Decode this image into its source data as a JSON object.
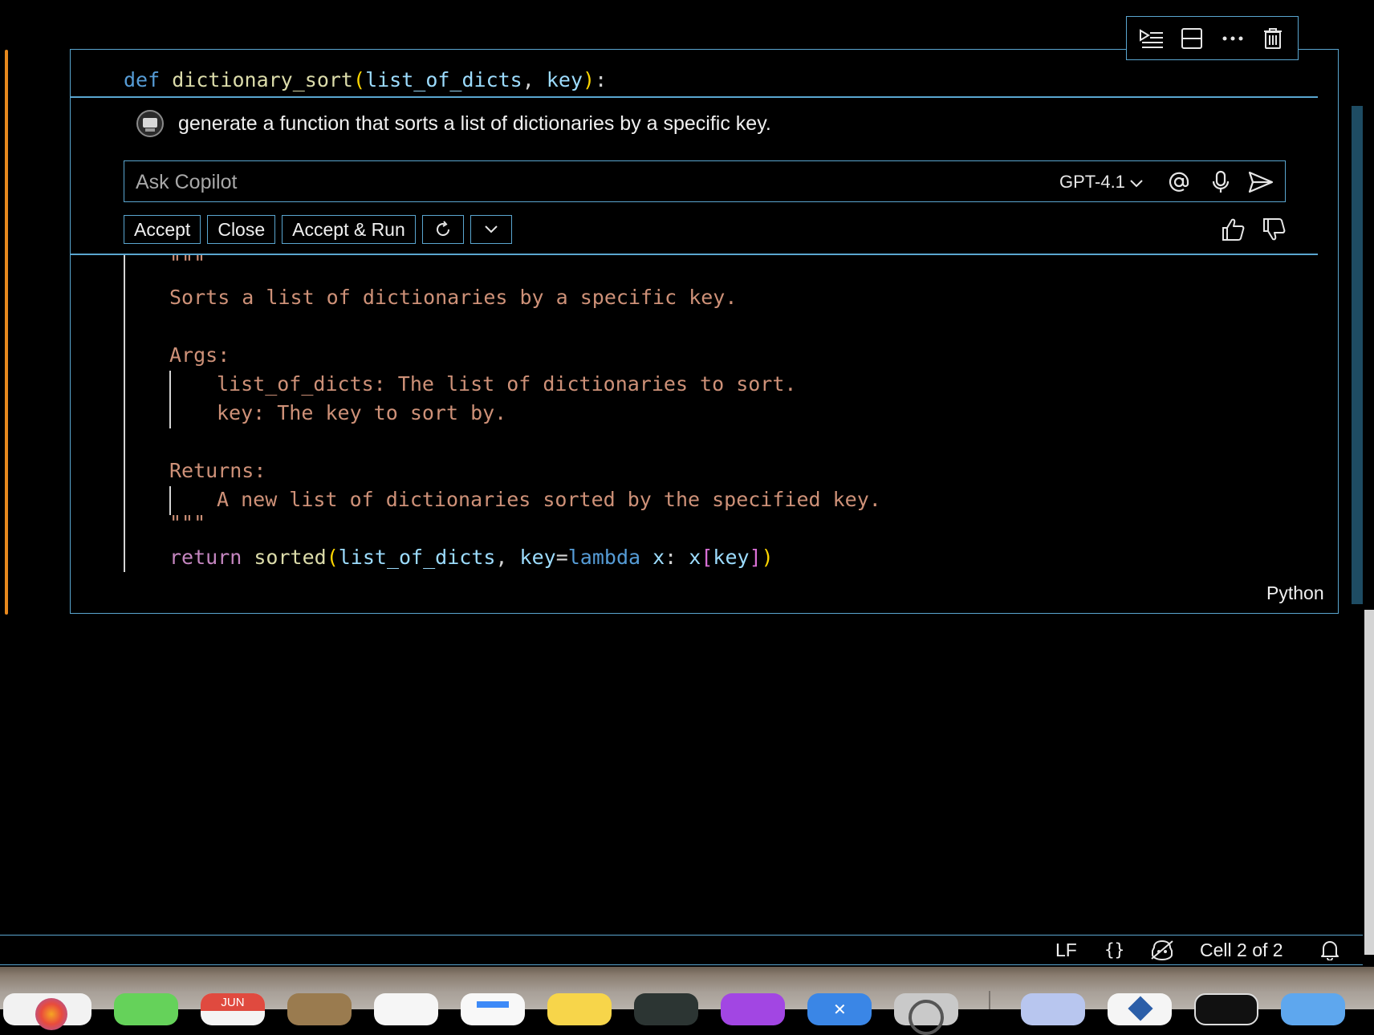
{
  "cell_toolbar": {
    "icons": [
      "execute-above-icon",
      "split-cell-icon",
      "more-actions-icon",
      "delete-cell-icon"
    ]
  },
  "code": {
    "signature": {
      "def": "def",
      "name": "dictionary_sort",
      "open": "(",
      "p1": "list_of_dicts",
      "comma": ", ",
      "p2": "key",
      "close": ")",
      "colon": ":"
    },
    "docstring": {
      "open_quotes": "\"\"\"",
      "summary": "Sorts a list of dictionaries by a specific key.",
      "args_header": "Args:",
      "arg1": "list_of_dicts: The list of dictionaries to sort.",
      "arg2": "key: The key to sort by.",
      "returns_header": "Returns:",
      "returns_desc": "A new list of dictionaries sorted by the specified key.",
      "close_quotes": "\"\"\""
    },
    "return_line": {
      "kw": "return",
      "fn": "sorted",
      "open": "(",
      "arg": "list_of_dicts",
      "comma": ", ",
      "key_kw": "key",
      "eq": "=",
      "lambda": "lambda",
      "x": " x",
      "colon": ": ",
      "x2": "x",
      "lb": "[",
      "key": "key",
      "rb": "]",
      "close": ")"
    },
    "language": "Python"
  },
  "chat": {
    "prompt": "generate a function that sorts a list of dictionaries by a specific key.",
    "input_placeholder": "Ask Copilot",
    "model": "GPT-4.1",
    "buttons": {
      "accept": "Accept",
      "close": "Close",
      "accept_run": "Accept & Run"
    }
  },
  "status_bar": {
    "eol": "LF",
    "braces": "{}",
    "cell_position": "Cell 2 of 2"
  },
  "dock": {
    "calendar_month": "JUN"
  },
  "colors": {
    "accent_border": "#5aa6d0",
    "modified_bar": "#e8891d",
    "keyword": "#569cd6",
    "function": "#dcdcaa",
    "string": "#ce9178",
    "control": "#c586c0"
  }
}
